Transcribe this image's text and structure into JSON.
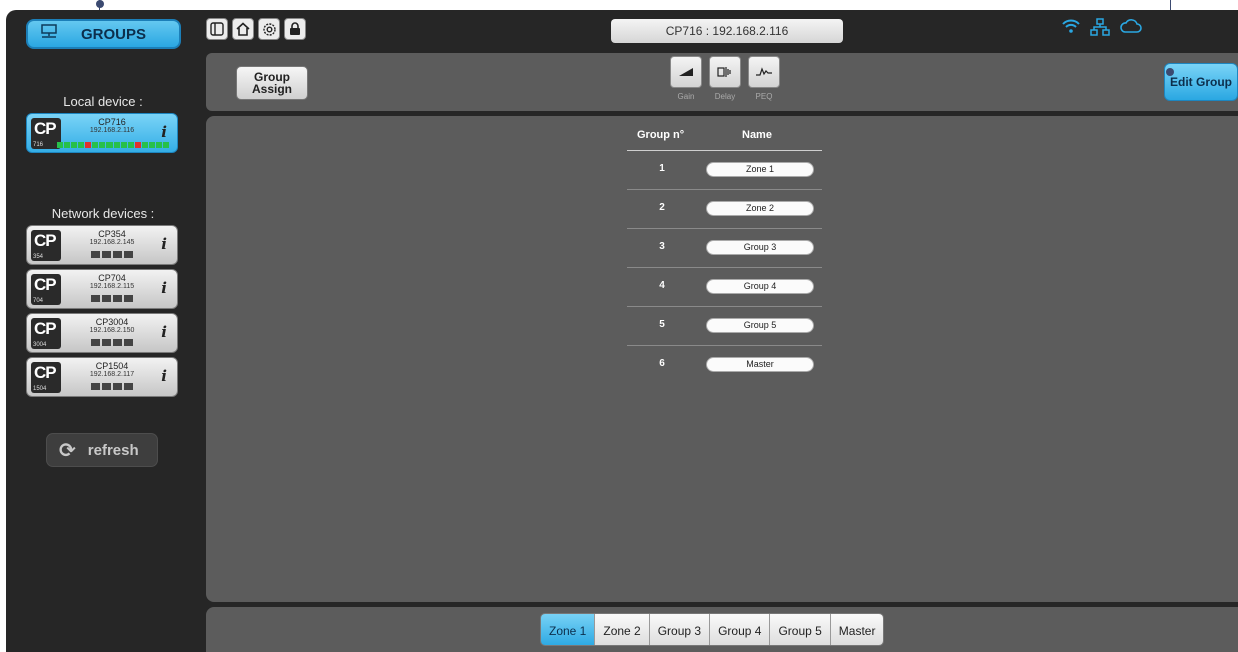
{
  "sidebar": {
    "groups_label": "GROUPS",
    "local_label": "Local device :",
    "local_device": {
      "name": "CP716",
      "ip": "192.168.2.116",
      "logo": "CP",
      "logo_num": "716"
    },
    "network_label": "Network devices :",
    "network_devices": [
      {
        "name": "CP354",
        "ip": "192.168.2.145",
        "logo": "CP",
        "logo_num": "354"
      },
      {
        "name": "CP704",
        "ip": "192.168.2.115",
        "logo": "CP",
        "logo_num": "704"
      },
      {
        "name": "CP3004",
        "ip": "192.168.2.150",
        "logo": "CP",
        "logo_num": "3004"
      },
      {
        "name": "CP1504",
        "ip": "192.168.2.117",
        "logo": "CP",
        "logo_num": "1504"
      }
    ],
    "info_glyph": "i",
    "refresh_label": "refresh"
  },
  "topbar": {
    "device_title": "CP716 : 192.168.2.116",
    "icons": [
      "sidebar-toggle-icon",
      "home-icon",
      "settings-icon",
      "lock-icon"
    ],
    "status_icons": [
      "wifi-icon",
      "network-icon",
      "cloud-icon"
    ]
  },
  "toolbar": {
    "group_assign_label": "Group Assign",
    "tools": [
      {
        "label": "Gain",
        "icon": "gain-icon"
      },
      {
        "label": "Delay",
        "icon": "delay-icon"
      },
      {
        "label": "PEQ",
        "icon": "peq-icon"
      }
    ],
    "edit_group_label": "Edit Group"
  },
  "groups_table": {
    "col_number": "Group n°",
    "col_name": "Name",
    "rows": [
      {
        "num": "1",
        "name": "Zone 1"
      },
      {
        "num": "2",
        "name": "Zone 2"
      },
      {
        "num": "3",
        "name": "Group 3"
      },
      {
        "num": "4",
        "name": "Group 4"
      },
      {
        "num": "5",
        "name": "Group 5"
      },
      {
        "num": "6",
        "name": "Master"
      }
    ]
  },
  "bottom_tabs": {
    "tabs": [
      "Zone 1",
      "Zone 2",
      "Group 3",
      "Group 4",
      "Group 5",
      "Master"
    ],
    "selected": "Zone 1"
  },
  "colors": {
    "accent": "#2aa7e2",
    "background": "#262626",
    "panel": "#5c5c5c"
  }
}
